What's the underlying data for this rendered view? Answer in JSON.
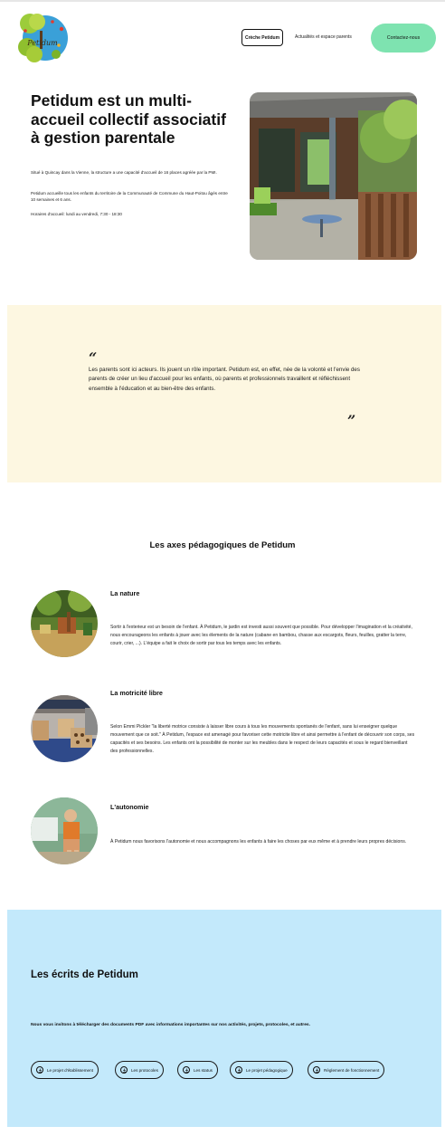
{
  "header": {
    "logo_text": "Petidum",
    "nav": {
      "creche": "Crèche Petidum",
      "actualites": "Actualités et espace parents",
      "contact": "Contactez-nous"
    }
  },
  "hero": {
    "title": "Petidum est un multi-accueil collectif associatif à gestion parentale",
    "p1": "Situé à Quincay dans la Vienne, la structure a une capacité d'accueil de 16 places agréée par la PMI.",
    "p2": "Petidum accueille tous les enfants du territoire de la Communauté de Commune du Haut-Poitou âgés entre 10 semaines et 6 ans.",
    "p3": "Horaires d'accueil: lundi au vendredi, 7:30 - 18:30"
  },
  "quote": {
    "open": "“",
    "text": "Les parents sont ici acteurs. Ils jouent un rôle important. Petidum est, en effet, née de la volonté et l'envie des parents de créer un lieu d'accueil pour les enfants, où parents et professionnels travaillent et réfléchissent ensemble à l'éducation et au bien-être des enfants.",
    "close": "”"
  },
  "axes": {
    "title": "Les axes pédagogiques de Petidum",
    "items": [
      {
        "title": "La nature",
        "text": "Sortir à l'exterieur est un besoin de l'enfant. À Petidum, le jardin est investi aussi souvent que possible. Pour développer l'imagination et la créativité, nous encourageons les enfants à jouer avec les élements de la nature (cabane en bambou, chasse aux escargots, fleurs, feuilles, gratter la terre, courir, crier, ...). L'équipe a fait le choix de sortir par tous les temps avec les enfants."
      },
      {
        "title": "La motricité libre",
        "text": "Selon Emmi Pickler \"la liberté motrice consiste à laisser libre cours à tous les mouvements spontanés de l'enfant, sans lui enseigner quelque mouvement que ce soit.\" À Petidum, l'espace est amenagé pour favoriser cette motricite libre et ainsi permettre à l'enfant de découvrir son corps, ses capacités et ses besoins. Les enfants ont la possibilité de monter sur les meubles dans le respect de leurs capacités et sous le regard bienveillant des professionnelles."
      },
      {
        "title": "L'autonomie",
        "text": "À Petidum nous favorisons l'autonomie et nous accompagnons les enfants à faire les choses par eux même et à prendre leurs propres décisions."
      }
    ]
  },
  "ecrits": {
    "title": "Les écrits de Petidum",
    "intro": "Nous vous invitons à télécharger des documents PDF avec informations importantes sur nos activités, projets, protocoles, et autres.",
    "buttons": [
      "Le projet d'établissement",
      "Les protocoles",
      "Les status",
      "Le projet pédagogique",
      "Règlement de fonctionnement"
    ]
  },
  "colors": {
    "contact_button": "#7ee3b0",
    "quote_background": "#fdf7e1",
    "ecrits_background": "#c3e9fb",
    "logo_circle": "#3aa0d8"
  }
}
